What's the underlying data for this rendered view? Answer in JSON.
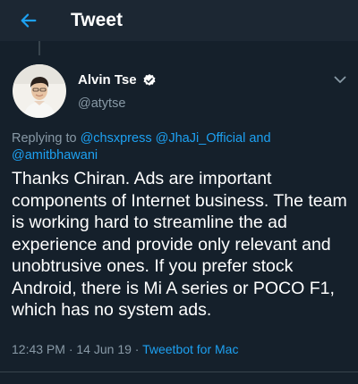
{
  "app_bar": {
    "title": "Tweet",
    "back_icon": "arrow-left-icon"
  },
  "tweet": {
    "author": {
      "name": "Alvin Tse",
      "handle": "@atytse",
      "verified_icon": "verified-badge-icon"
    },
    "reply_to": {
      "prefix": "Replying to",
      "mentions": [
        "@chsxpress",
        "@JhaJi_Official",
        "@amitbhawani"
      ],
      "conjunction": "and"
    },
    "text": "Thanks Chiran. Ads are important components of Internet business. The team is working hard to streamline the ad experience and provide only relevant and unobtrusive ones. If you prefer stock Android, there is Mi A series or POCO F1, which has no system ads.",
    "time": "12:43 PM",
    "date": "14 Jun 19",
    "separator": "·",
    "source": "Tweetbot for Mac"
  },
  "colors": {
    "background": "#15202b",
    "app_bar": "#1c2733",
    "accent": "#1da1f2",
    "secondary_text": "#8899a6",
    "divider": "#38444d"
  }
}
